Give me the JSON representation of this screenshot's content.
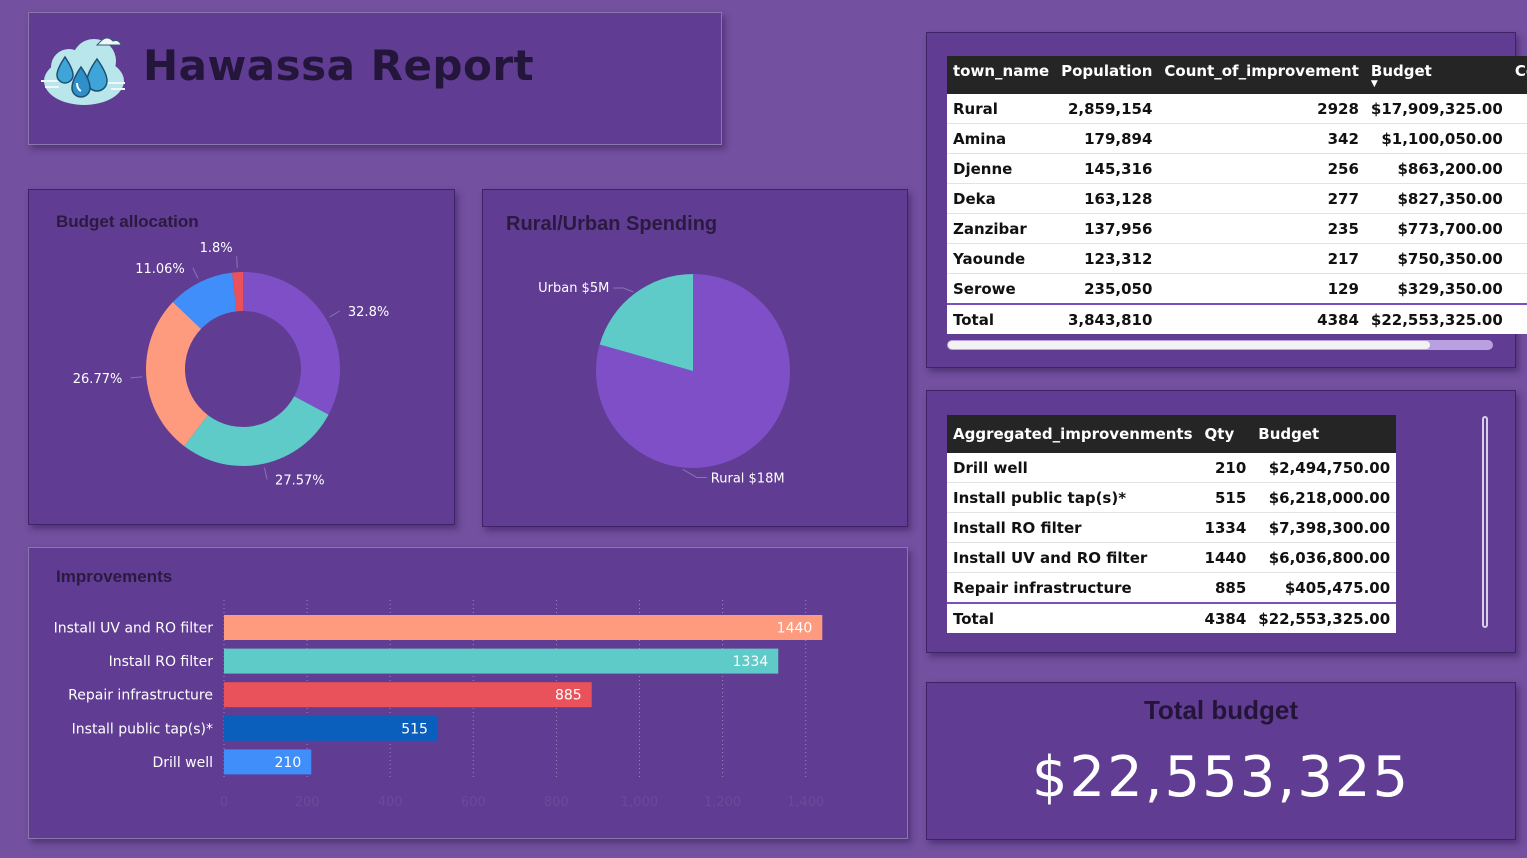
{
  "header": {
    "title": "Hawassa Report"
  },
  "budget_allocation": {
    "title": "Budget allocation"
  },
  "rural_urban": {
    "title": "Rural/Urban Spending"
  },
  "improvements": {
    "title": "Improvements"
  },
  "chart_data": [
    {
      "type": "donut",
      "title": "Budget allocation",
      "labels": [
        "32.8%",
        "27.57%",
        "26.77%",
        "11.06%",
        "1.8%"
      ],
      "values": [
        32.8,
        27.57,
        26.77,
        11.06,
        1.8
      ],
      "colors": [
        "#7f4fc8",
        "#5ecbc8",
        "#fe9a7e",
        "#3f8efa",
        "#e9525a"
      ]
    },
    {
      "type": "pie",
      "title": "Rural/Urban Spending",
      "labels": [
        "Rural $18M",
        "Urban $5M"
      ],
      "values": [
        17909325,
        4644000
      ],
      "colors": [
        "#7f4fc8",
        "#5ecbc8"
      ]
    },
    {
      "type": "bar",
      "orientation": "horizontal",
      "title": "Improvements",
      "categories": [
        "Install UV and RO filter",
        "Install RO filter",
        "Repair infrastructure",
        "Install public tap(s)*",
        "Drill well"
      ],
      "values": [
        1440,
        1334,
        885,
        515,
        210
      ],
      "colors": [
        "#fe9a7e",
        "#5ecbc8",
        "#e9525a",
        "#0a5fbd",
        "#3f8efa"
      ],
      "xlim": [
        0,
        1400
      ],
      "xticks": [
        "0",
        "200",
        "400",
        "600",
        "800",
        "1,000",
        "1,200",
        "1,400"
      ],
      "grid": true
    }
  ],
  "town_table": {
    "columns": [
      "town_name",
      "Population",
      "Count_of_improvement",
      "Budget",
      "Cost"
    ],
    "rows": [
      [
        "Rural",
        "2,859,154",
        "2928",
        "$17,909,325.00"
      ],
      [
        "Amina",
        "179,894",
        "342",
        "$1,100,050.00"
      ],
      [
        "Djenne",
        "145,316",
        "256",
        "$863,200.00"
      ],
      [
        "Deka",
        "163,128",
        "277",
        "$827,350.00"
      ],
      [
        "Zanzibar",
        "137,956",
        "235",
        "$773,700.00"
      ],
      [
        "Yaounde",
        "123,312",
        "217",
        "$750,350.00"
      ],
      [
        "Serowe",
        "235,050",
        "129",
        "$329,350.00"
      ]
    ],
    "total": [
      "Total",
      "3,843,810",
      "4384",
      "$22,553,325.00"
    ]
  },
  "agg_table": {
    "columns": [
      "Aggregated_improvenments",
      "Qty",
      "Budget"
    ],
    "rows": [
      [
        "Drill well",
        "210",
        "$2,494,750.00"
      ],
      [
        "Install public tap(s)*",
        "515",
        "$6,218,000.00"
      ],
      [
        "Install RO filter",
        "1334",
        "$7,398,300.00"
      ],
      [
        "Install UV and RO filter",
        "1440",
        "$6,036,800.00"
      ],
      [
        "Repair infrastructure",
        "885",
        "$405,475.00"
      ]
    ],
    "total": [
      "Total",
      "4384",
      "$22,553,325.00"
    ]
  },
  "total_budget": {
    "label": "Total budget",
    "value": "$22,553,325"
  },
  "icons": {
    "logo": "water-drops-cloud-icon",
    "sort": "sort-desc-icon"
  }
}
